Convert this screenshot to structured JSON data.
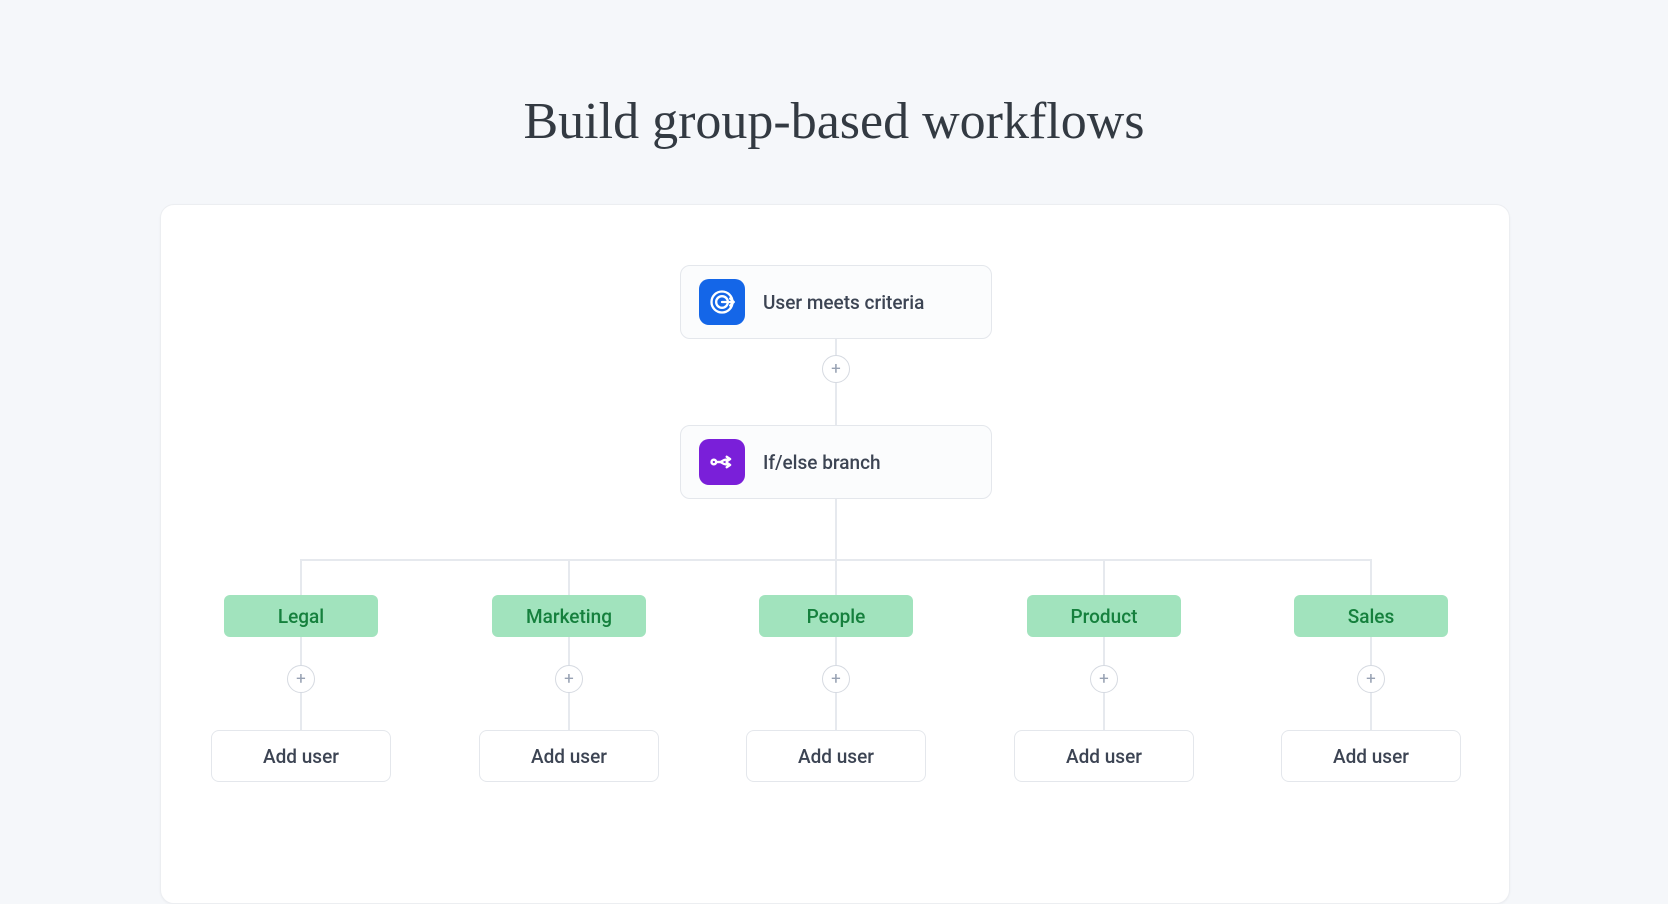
{
  "title": "Build group-based workflows",
  "nodes": {
    "criteria": {
      "label": "User meets criteria"
    },
    "branch": {
      "label": "If/else branch"
    }
  },
  "branches": [
    {
      "label": "Legal",
      "action": "Add user"
    },
    {
      "label": "Marketing",
      "action": "Add user"
    },
    {
      "label": "People",
      "action": "Add user"
    },
    {
      "label": "Product",
      "action": "Add user"
    },
    {
      "label": "Sales",
      "action": "Add user"
    }
  ],
  "colors": {
    "page_bg": "#f5f7fa",
    "canvas_bg": "#ffffff",
    "border": "#e4e7ec",
    "criteria_icon_bg": "#1466e8",
    "branch_icon_bg": "#7a1fd9",
    "pill_bg": "#a1e3bd",
    "pill_text": "#15803d"
  }
}
